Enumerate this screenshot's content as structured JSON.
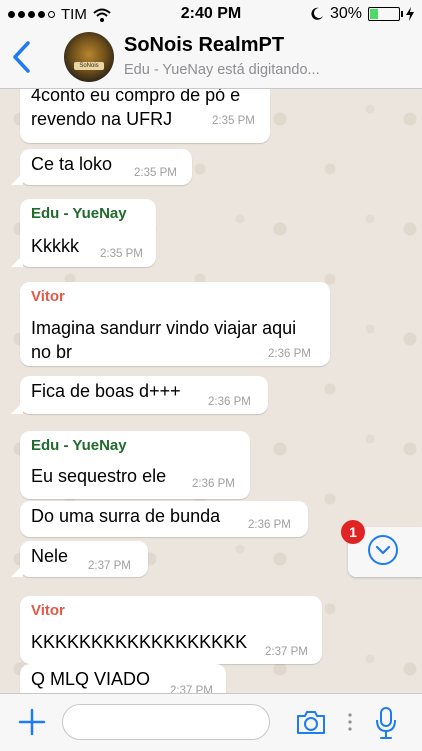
{
  "status_bar": {
    "carrier": "TIM",
    "time": "2:40 PM",
    "battery": "30%",
    "battery_level": 0.3
  },
  "header": {
    "back_icon": "chevron-left-icon",
    "title": "SoNois RealmPT",
    "subtitle": "Edu - YueNay está digitando...",
    "avatar_badge": "SoNois"
  },
  "colors": {
    "accent": "#1e7cf2",
    "sender_edu": "#1f6b2c",
    "sender_vitor": "#e05a4a",
    "unread_badge": "#e02424"
  },
  "messages": [
    {
      "text1": "4conto eu compro de pó e",
      "text2": "revendo na UFRJ",
      "time": "2:35 PM"
    },
    {
      "text1": "Ce ta loko",
      "time": "2:35 PM"
    },
    {
      "sender": "Edu - YueNay",
      "text1": "Kkkkk",
      "time": "2:35 PM"
    },
    {
      "sender": "Vitor",
      "text1": "Imagina sandurr vindo viajar aqui",
      "text2": "no br",
      "time": "2:36 PM"
    },
    {
      "text1": "Fica de boas d+++",
      "time": "2:36 PM"
    },
    {
      "sender": "Edu - YueNay",
      "text1": "Eu sequestro ele",
      "time": "2:36 PM"
    },
    {
      "text1": "Do uma surra de bunda",
      "time": "2:36 PM"
    },
    {
      "text1": "Nele",
      "time": "2:37 PM"
    },
    {
      "sender": "Vitor",
      "text1": "KKKKKKKKKKKKKKKKKK",
      "time": "2:37 PM"
    },
    {
      "text1": "Q MLQ VIADO",
      "time": "2:37 PM"
    }
  ],
  "scroll_button": {
    "unread_count": "1",
    "icon": "chevron-down-icon"
  },
  "composer": {
    "placeholder": "",
    "plus_icon": "plus-icon",
    "camera_icon": "camera-icon",
    "mic_icon": "microphone-icon"
  }
}
